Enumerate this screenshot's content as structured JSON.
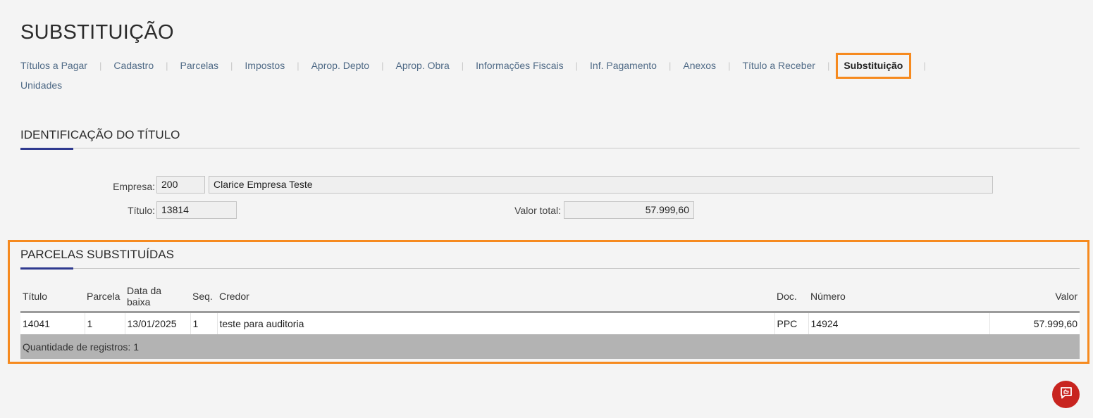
{
  "page": {
    "title": "SUBSTITUIÇÃO"
  },
  "nav": {
    "items": [
      {
        "label": "Títulos a Pagar"
      },
      {
        "label": "Cadastro"
      },
      {
        "label": "Parcelas"
      },
      {
        "label": "Impostos"
      },
      {
        "label": "Aprop. Depto"
      },
      {
        "label": "Aprop. Obra"
      },
      {
        "label": "Informações Fiscais"
      },
      {
        "label": "Inf. Pagamento"
      },
      {
        "label": "Anexos"
      },
      {
        "label": "Título a Receber"
      },
      {
        "label": "Substituição"
      },
      {
        "label": "Unidades"
      }
    ],
    "separator": "|"
  },
  "identificacao": {
    "title": "IDENTIFICAÇÃO DO TÍTULO",
    "empresa_label": "Empresa:",
    "empresa_code": "200",
    "empresa_name": "Clarice Empresa Teste",
    "titulo_label": "Título:",
    "titulo_value": "13814",
    "valor_label": "Valor total:",
    "valor_value": "57.999,60"
  },
  "parcelas": {
    "title": "PARCELAS SUBSTITUÍDAS",
    "columns": [
      "Título",
      "Parcela",
      "Data da baixa",
      "Seq.",
      "Credor",
      "Doc.",
      "Número",
      "Valor"
    ],
    "rows": [
      [
        "14041",
        "1",
        "13/01/2025",
        "1",
        "teste para auditoria",
        "PPC",
        "14924",
        "57.999,60"
      ]
    ],
    "footer": "Quantidade de registros: 1"
  },
  "colors": {
    "accent": "#2f3a8f",
    "highlight": "#f68a1f",
    "chat_button": "#c8241f"
  },
  "icons": {
    "chat": "chat-feedback-icon"
  }
}
